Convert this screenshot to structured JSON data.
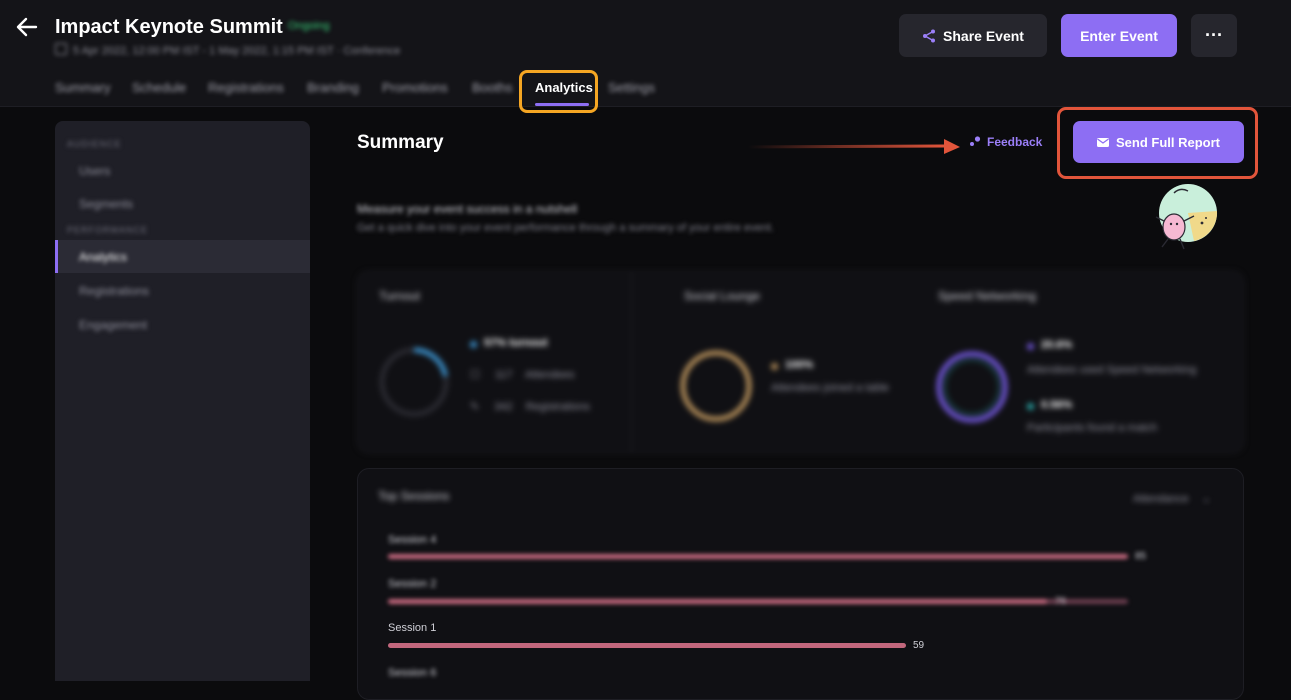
{
  "header": {
    "title": "Impact Keynote Summit",
    "status": "Ongoing",
    "meta": "5 Apr 2022, 12:00 PM IST - 1 May 2022, 1:15 PM IST · Conference",
    "buttons": {
      "share": "Share Event",
      "enter": "Enter Event",
      "more": "···"
    }
  },
  "tabs": [
    "Summary",
    "Schedule",
    "Registrations",
    "Branding",
    "Promotions",
    "Booths",
    "Analytics",
    "Settings"
  ],
  "active_tab": "Analytics",
  "sidebar": {
    "section_1": "AUDIENCE",
    "items_1": [
      "Users",
      "Segments"
    ],
    "section_2": "PERFORMANCE",
    "items_2": [
      "Analytics",
      "Registrations",
      "Engagement"
    ]
  },
  "main": {
    "title": "Summary",
    "feedback": "Feedback",
    "send_report": "Send Full Report",
    "intro_title": "Measure your event success in a nutshell",
    "intro_subtitle": "Get a quick dive into your event performance through a summary of your entire event."
  },
  "cards": {
    "turnout": {
      "title": "Turnout",
      "value_label": "57% turnout",
      "attendees_count": "117",
      "attendees_label": "Attendees",
      "registrations_count": "342",
      "registrations_label": "Registrations",
      "percent": 22
    },
    "lounge": {
      "title": "Social Lounge",
      "value_label": "100%",
      "desc": "Attendees joined a table",
      "percent": 100
    },
    "networking": {
      "title": "Speed Networking",
      "value_1": "20.6%",
      "desc_1": "Attendees used Speed Networking",
      "value_2": "0.56%",
      "desc_2": "Participants found a match",
      "percent": 100
    }
  },
  "sessions": {
    "title": "Top Sessions",
    "filter": "Attendance",
    "rows": [
      {
        "label": "Session 4",
        "value": "85",
        "fraction": 1.0
      },
      {
        "label": "Session 2",
        "value": "76",
        "fraction": 0.89
      },
      {
        "label": "Session 1",
        "value": "59",
        "fraction": 0.67
      },
      {
        "label": "Session 6",
        "value": "",
        "fraction": 0.5
      }
    ]
  },
  "colors": {
    "accent": "#8d6ef3",
    "turnout": "#3a8fc9",
    "lounge": "#b58f5a",
    "networking": "#6f55d6",
    "networking_2": "#2aa6a6",
    "bars": "#c2677d",
    "tab_highlight": "#f5a623",
    "report_highlight": "#e2553b"
  },
  "icons": [
    "back-arrow-icon",
    "calendar-icon",
    "share-icon",
    "mail-icon",
    "more-icon",
    "feedback-icon",
    "people-icon",
    "pencil-icon",
    "chevron-down-icon"
  ]
}
